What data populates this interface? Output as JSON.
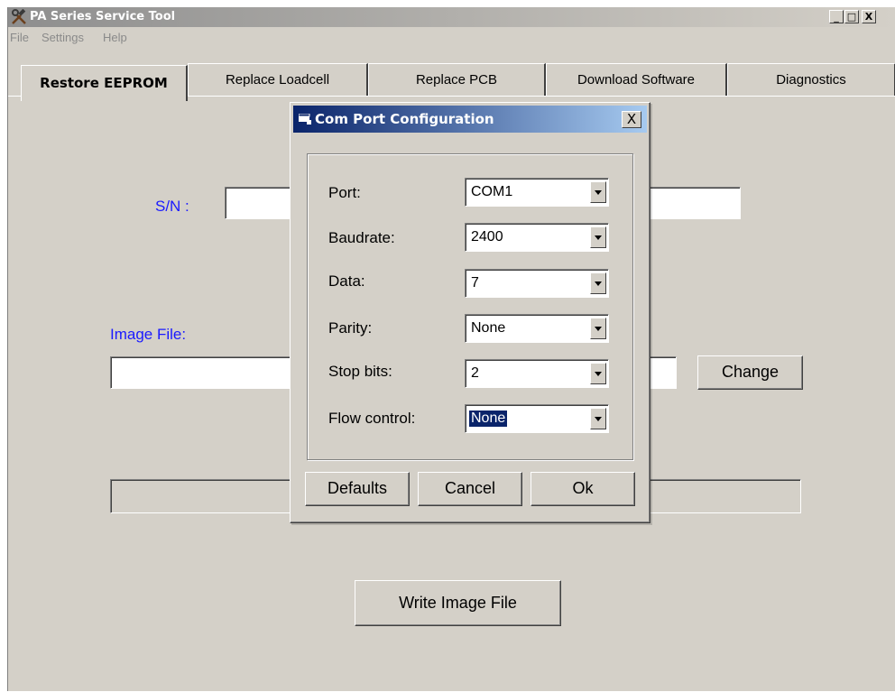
{
  "window": {
    "title": "PA Series Service Tool",
    "controls": {
      "minimize": "_",
      "maximize": "□",
      "close": "X"
    }
  },
  "menu": [
    "File",
    "Settings",
    "Help"
  ],
  "tabs": [
    "Restore EEPROM",
    "Replace Loadcell",
    "Replace PCB",
    "Download Software",
    "Diagnostics"
  ],
  "active_tab": "Restore EEPROM",
  "restore_panel": {
    "sn_label": "S/N :",
    "sn_value": "",
    "image_file_label": "Image File:",
    "image_file_value": "",
    "change_button": "Change",
    "status_value": "",
    "write_button": "Write Image File"
  },
  "dialog": {
    "title": "Com Port Configuration",
    "close_label": "X",
    "fields": [
      {
        "label": "Port:",
        "value": "COM1"
      },
      {
        "label": "Baudrate:",
        "value": "2400"
      },
      {
        "label": "Data:",
        "value": "7"
      },
      {
        "label": "Parity:",
        "value": "None"
      },
      {
        "label": "Stop bits:",
        "value": "2"
      },
      {
        "label": "Flow control:",
        "value": "None"
      }
    ],
    "buttons": {
      "defaults": "Defaults",
      "cancel": "Cancel",
      "ok": "Ok"
    }
  },
  "colors": {
    "face": "#d4d0c8",
    "dialog_title": "#0a246a",
    "label_blue": "#1a1aff",
    "selection": "#0a246a"
  }
}
